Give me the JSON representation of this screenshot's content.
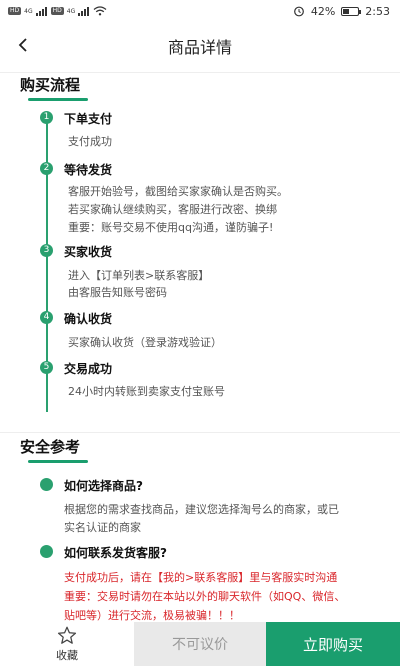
{
  "status_bar": {
    "chip1": "HD",
    "net1": "4G",
    "chip2": "HD",
    "net2": "4G",
    "battery_text": "42%",
    "battery_level": 0.42,
    "time": "2:53"
  },
  "header": {
    "title": "商品详情"
  },
  "purchase": {
    "title": "购买流程",
    "steps": [
      {
        "num": "1",
        "title": "下单支付",
        "lines": [
          "支付成功"
        ]
      },
      {
        "num": "2",
        "title": "等待发货",
        "lines": [
          "客服开始验号，截图给买家家确认是否购买。",
          "若买家确认继续购买，客服进行改密、换绑",
          "重要：账号交易不使用qq沟通，谨防骗子!"
        ]
      },
      {
        "num": "3",
        "title": "买家收货",
        "lines": [
          "进入【订单列表>联系客服】",
          "由客服告知账号密码"
        ]
      },
      {
        "num": "4",
        "title": "确认收货",
        "lines": [
          "买家确认收货（登录游戏验证）"
        ]
      },
      {
        "num": "5",
        "title": "交易成功",
        "lines": [
          "24小时内转账到卖家支付宝账号"
        ]
      }
    ]
  },
  "safety": {
    "title": "安全参考",
    "q1": "如何选择商品?",
    "a1_line1": "根据您的需求查找商品，建议您选择淘号么的商家，或已",
    "a1_line2": "实名认证的商家",
    "q2": "如何联系发货客服?",
    "a2_line1": "支付成功后，请在【我的>联系客服】里与客服实时沟通",
    "a2_line2": "重要：交易时请勿在本站以外的聊天软件（如QQ、微信、",
    "a2_line3": "贴吧等）进行交流，极易被骗！！！"
  },
  "bottom": {
    "fav_label": "收藏",
    "no_bargain": "不可议价",
    "buy_now": "立即购买"
  },
  "colors": {
    "accent": "#1a9e6e",
    "warning": "#d9262b"
  }
}
